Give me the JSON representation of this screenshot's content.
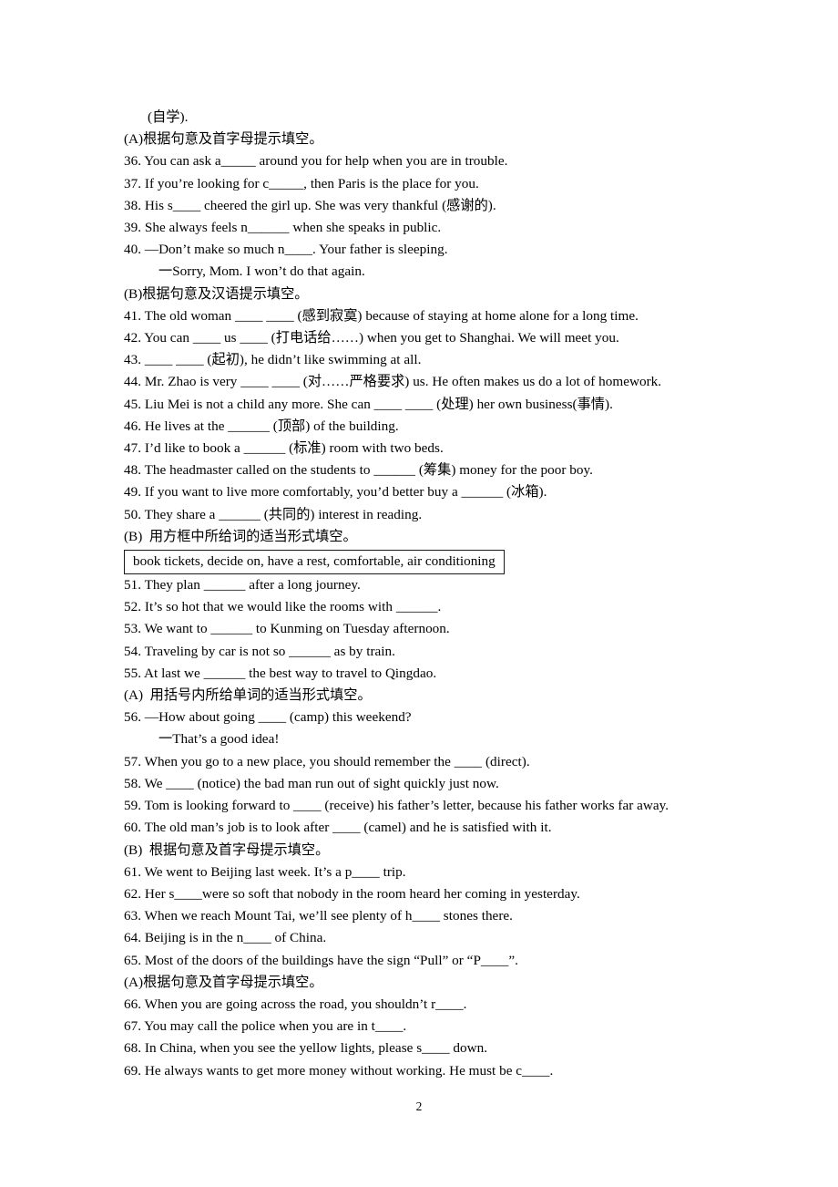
{
  "page": {
    "number": "2",
    "background_color": "#ffffff",
    "text_color": "#000000"
  },
  "blocks": [
    {
      "kind": "line",
      "indent": "indent",
      "text": "(自学)."
    },
    {
      "kind": "heading",
      "indent": "none",
      "text": "(A)根据句意及首字母提示填空。"
    },
    {
      "kind": "line",
      "indent": "none",
      "text": "36. You can ask a_____ around you for help when you are in trouble."
    },
    {
      "kind": "line",
      "indent": "none",
      "text": "37. If you’re looking for c_____, then Paris is the place for you."
    },
    {
      "kind": "line",
      "indent": "none",
      "text": "38. His s____ cheered the girl up. She was very thankful (感谢的)."
    },
    {
      "kind": "line",
      "indent": "none",
      "text": "39. She always feels n______ when she speaks in public."
    },
    {
      "kind": "line",
      "indent": "none",
      "text": "40. —Don’t make so much n____. Your father is sleeping."
    },
    {
      "kind": "line",
      "indent": "indent2",
      "text": "一Sorry, Mom. I won’t do that again."
    },
    {
      "kind": "heading",
      "indent": "none",
      "text": "(B)根据句意及汉语提示填空。"
    },
    {
      "kind": "line",
      "indent": "none",
      "text": "41. The old woman ____ ____ (感到寂寞) because of staying at home alone for a long time."
    },
    {
      "kind": "line",
      "indent": "none",
      "text": "42. You can ____ us ____ (打电话给……) when you get to Shanghai. We will meet you."
    },
    {
      "kind": "line",
      "indent": "none",
      "text": "43. ____ ____ (起初), he didn’t like swimming at all."
    },
    {
      "kind": "line",
      "indent": "none",
      "text": "44. Mr. Zhao is very ____ ____ (对……严格要求) us. He often makes us do a lot of homework."
    },
    {
      "kind": "line",
      "indent": "none",
      "text": "45. Liu Mei is not a child any more. She can ____ ____ (处理) her own business(事情)."
    },
    {
      "kind": "line",
      "indent": "none",
      "text": "46. He lives at the ______ (顶部) of the building."
    },
    {
      "kind": "line",
      "indent": "none",
      "text": "47. I’d like to book a ______ (标准) room with two beds."
    },
    {
      "kind": "line",
      "indent": "none",
      "text": "48. The headmaster called on the students to ______ (筹集) money for the poor boy."
    },
    {
      "kind": "line",
      "indent": "none",
      "text": "49. If you want to live more comfortably, you’d better buy a ______ (冰箱)."
    },
    {
      "kind": "line",
      "indent": "none",
      "text": "50. They share a ______ (共同的) interest in reading."
    },
    {
      "kind": "heading",
      "indent": "none",
      "text": "(B)  用方框中所给词的适当形式填空。"
    },
    {
      "kind": "wordbank",
      "indent": "none",
      "text": "book tickets, decide on, have a rest, comfortable, air conditioning"
    },
    {
      "kind": "line",
      "indent": "none",
      "text": "51. They plan ______ after a long journey."
    },
    {
      "kind": "line",
      "indent": "none",
      "text": "52. It’s so hot that we would like the rooms with ______."
    },
    {
      "kind": "line",
      "indent": "none",
      "text": "53. We want to ______ to Kunming on Tuesday afternoon."
    },
    {
      "kind": "line",
      "indent": "none",
      "text": "54. Traveling by car is not so ______ as by train."
    },
    {
      "kind": "line",
      "indent": "none",
      "text": "55. At last we ______ the best way to travel to Qingdao."
    },
    {
      "kind": "heading",
      "indent": "none",
      "text": "(A)  用括号内所给单词的适当形式填空。"
    },
    {
      "kind": "line",
      "indent": "none",
      "text": "56. —How about going ____ (camp) this weekend?"
    },
    {
      "kind": "line",
      "indent": "indent2",
      "text": "一That’s a good idea!"
    },
    {
      "kind": "line",
      "indent": "none",
      "text": "57. When you go to a new place, you should remember the ____ (direct)."
    },
    {
      "kind": "line",
      "indent": "none",
      "text": "58. We ____ (notice) the bad man run out of sight quickly just now."
    },
    {
      "kind": "line",
      "indent": "none",
      "text": "59. Tom is looking forward to ____ (receive) his father’s letter, because his father works far away."
    },
    {
      "kind": "line",
      "indent": "none",
      "text": "60. The old man’s job is to look after ____ (camel) and he is satisfied with it."
    },
    {
      "kind": "heading",
      "indent": "none",
      "text": "(B)  根据句意及首字母提示填空。"
    },
    {
      "kind": "line",
      "indent": "none",
      "text": "61. We went to Beijing last week. It’s a p____ trip."
    },
    {
      "kind": "line",
      "indent": "none",
      "text": "62. Her s____were so soft that nobody in the room heard her coming in yesterday."
    },
    {
      "kind": "line",
      "indent": "none",
      "text": "63. When we reach Mount Tai, we’ll see plenty of h____ stones there."
    },
    {
      "kind": "line",
      "indent": "none",
      "text": "64. Beijing is in the n____ of China."
    },
    {
      "kind": "line",
      "indent": "none",
      "text": "65. Most of the doors of the buildings have the sign “Pull” or “P____”."
    },
    {
      "kind": "heading",
      "indent": "none",
      "text": "(A)根据句意及首字母提示填空。"
    },
    {
      "kind": "line",
      "indent": "none",
      "text": "66. When you are going across the road, you shouldn’t r____."
    },
    {
      "kind": "line",
      "indent": "none",
      "text": "67. You may call the police when you are in t____."
    },
    {
      "kind": "line",
      "indent": "none",
      "text": "68. In China, when you see the yellow lights, please s____ down."
    },
    {
      "kind": "line",
      "indent": "none",
      "text": "69. He always wants to get more money without working. He must be c____."
    }
  ]
}
